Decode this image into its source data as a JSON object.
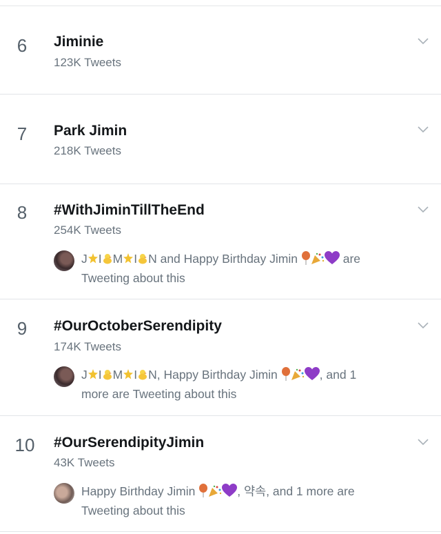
{
  "trends": [
    {
      "rank": "6",
      "title": "Jiminie",
      "count": "123K Tweets"
    },
    {
      "rank": "7",
      "title": "Park Jimin",
      "count": "218K Tweets"
    },
    {
      "rank": "8",
      "title": "#WithJiminTillTheEnd",
      "count": "254K Tweets",
      "context": {
        "name_letters": [
          "J",
          "I",
          "M",
          "I",
          "N"
        ],
        "line1_after_name": " and Happy Birthday Jimin ",
        "line1_tail": " are",
        "line2": "Tweeting about this"
      }
    },
    {
      "rank": "9",
      "title": "#OurOctoberSerendipity",
      "count": "174K Tweets",
      "context": {
        "name_letters": [
          "J",
          "I",
          "M",
          "I",
          "N"
        ],
        "line1_after_name": ", Happy Birthday Jimin ",
        "line1_tail": ", and 1",
        "line2": "more are Tweeting about this"
      }
    },
    {
      "rank": "10",
      "title": "#OurSerendipityJimin",
      "count": "43K Tweets",
      "context": {
        "line1_head": "Happy Birthday Jimin ",
        "line1_tail": ", 약속, and 1 more are",
        "line2": "Tweeting about this"
      }
    }
  ],
  "icons": {
    "chevron": "chevron-down-icon",
    "star": "star-emoji-icon",
    "chick": "chick-emoji-icon",
    "balloon": "balloon-emoji-icon",
    "party": "party-popper-emoji-icon",
    "heart": "purple-heart-emoji-icon"
  },
  "colors": {
    "rank": "#55606a",
    "title": "#14171a",
    "secondary": "#68737d",
    "divider": "#e1e4e7",
    "heart": "#8e3cc7",
    "balloon": "#e0703a"
  }
}
